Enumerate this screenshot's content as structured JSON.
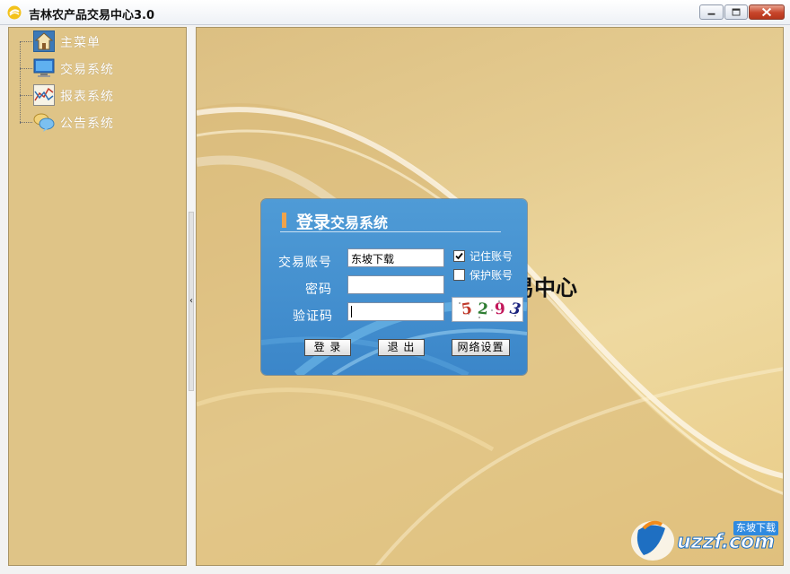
{
  "window": {
    "title": "吉林农产品交易中心3.0",
    "icon": "app-logo-icon"
  },
  "sidebar": {
    "items": [
      {
        "label": "主菜单",
        "icon": "home-menu-icon"
      },
      {
        "label": "交易系统",
        "icon": "monitor-icon"
      },
      {
        "label": "报表系统",
        "icon": "chart-icon"
      },
      {
        "label": "公告系统",
        "icon": "chat-bubble-icon"
      }
    ]
  },
  "main": {
    "background_text": "易中心"
  },
  "login": {
    "title_big": "登录",
    "title_small": "交易系统",
    "account_label": "交易账号",
    "account_value": "东坡下载",
    "password_label": "密码",
    "password_value": "",
    "captcha_label": "验证码",
    "captcha_value": "",
    "remember_label": "记住账号",
    "remember_checked": true,
    "protect_label": "保护账号",
    "protect_checked": false,
    "captcha_digits": [
      "5",
      "2",
      "9",
      "3"
    ],
    "login_button": "登 录",
    "exit_button": "退 出",
    "network_button": "网络设置"
  },
  "watermark": {
    "text": "uzzf.com",
    "badge": "东坡下载"
  },
  "colors": {
    "sidebar_bg": "#dfc487",
    "dialog_bg": "#4a96d3",
    "accent": "#f0a34a"
  }
}
